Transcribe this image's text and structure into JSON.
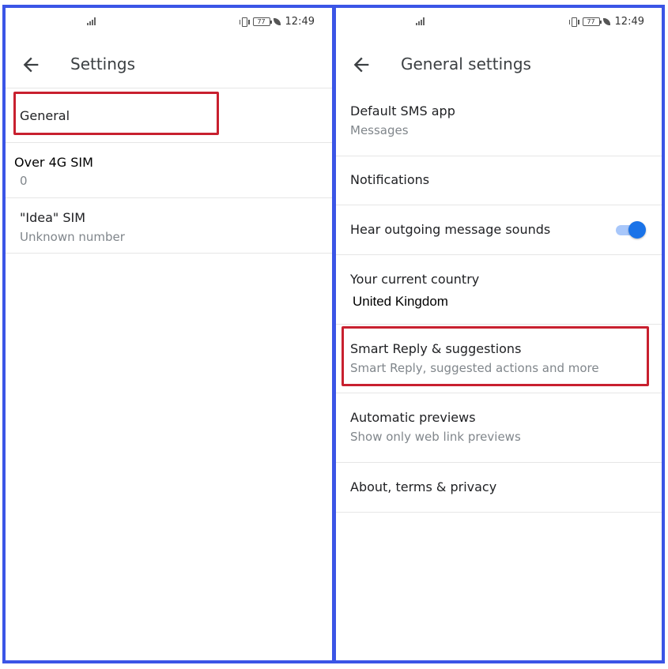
{
  "status_bar": {
    "time": "12:49",
    "battery": "77"
  },
  "left_panel": {
    "title": "Settings",
    "items": [
      {
        "title": "General",
        "subtitle": ""
      },
      {
        "title": "Over 4G  SIM",
        "subtitle": "0"
      },
      {
        "title": "\"Idea\" SIM",
        "subtitle": "Unknown number"
      }
    ]
  },
  "right_panel": {
    "title": "General settings",
    "items": [
      {
        "title": "Default SMS app",
        "subtitle": "Messages"
      },
      {
        "title": "Notifications",
        "subtitle": ""
      },
      {
        "title": "Hear outgoing message sounds",
        "subtitle": "",
        "toggle_on": true
      },
      {
        "title": "Your current country",
        "subtitle": "United Kingdom"
      },
      {
        "title": "Smart Reply & suggestions",
        "subtitle": "Smart Reply, suggested actions and more"
      },
      {
        "title": "Automatic previews",
        "subtitle": "Show only web link previews"
      },
      {
        "title": "About, terms & privacy",
        "subtitle": ""
      }
    ]
  },
  "colors": {
    "panel_border": "#3b55e6",
    "highlight": "#c8202f",
    "toggle_accent": "#1a73e8"
  },
  "icons": [
    "signal-icon",
    "vibrate-icon",
    "battery-icon",
    "leaf-icon",
    "back-arrow-icon"
  ]
}
